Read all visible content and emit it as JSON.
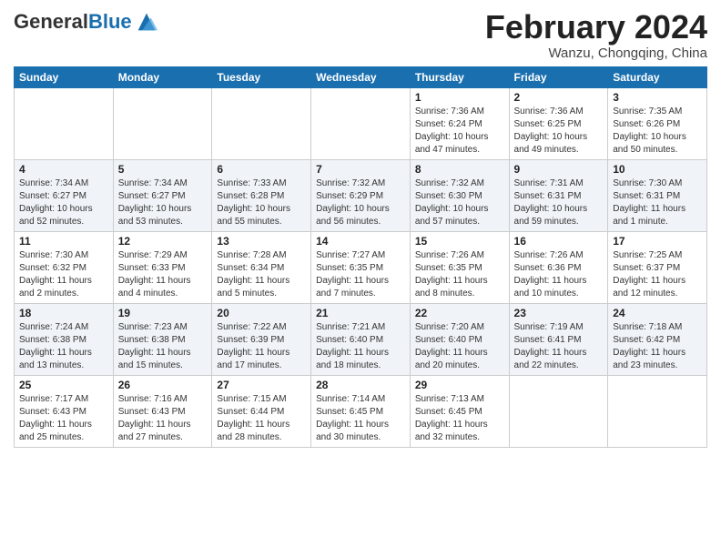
{
  "header": {
    "logo_general": "General",
    "logo_blue": "Blue",
    "month_title": "February 2024",
    "location": "Wanzu, Chongqing, China"
  },
  "weekdays": [
    "Sunday",
    "Monday",
    "Tuesday",
    "Wednesday",
    "Thursday",
    "Friday",
    "Saturday"
  ],
  "weeks": [
    [
      {
        "day": "",
        "detail": ""
      },
      {
        "day": "",
        "detail": ""
      },
      {
        "day": "",
        "detail": ""
      },
      {
        "day": "",
        "detail": ""
      },
      {
        "day": "1",
        "detail": "Sunrise: 7:36 AM\nSunset: 6:24 PM\nDaylight: 10 hours\nand 47 minutes."
      },
      {
        "day": "2",
        "detail": "Sunrise: 7:36 AM\nSunset: 6:25 PM\nDaylight: 10 hours\nand 49 minutes."
      },
      {
        "day": "3",
        "detail": "Sunrise: 7:35 AM\nSunset: 6:26 PM\nDaylight: 10 hours\nand 50 minutes."
      }
    ],
    [
      {
        "day": "4",
        "detail": "Sunrise: 7:34 AM\nSunset: 6:27 PM\nDaylight: 10 hours\nand 52 minutes."
      },
      {
        "day": "5",
        "detail": "Sunrise: 7:34 AM\nSunset: 6:27 PM\nDaylight: 10 hours\nand 53 minutes."
      },
      {
        "day": "6",
        "detail": "Sunrise: 7:33 AM\nSunset: 6:28 PM\nDaylight: 10 hours\nand 55 minutes."
      },
      {
        "day": "7",
        "detail": "Sunrise: 7:32 AM\nSunset: 6:29 PM\nDaylight: 10 hours\nand 56 minutes."
      },
      {
        "day": "8",
        "detail": "Sunrise: 7:32 AM\nSunset: 6:30 PM\nDaylight: 10 hours\nand 57 minutes."
      },
      {
        "day": "9",
        "detail": "Sunrise: 7:31 AM\nSunset: 6:31 PM\nDaylight: 10 hours\nand 59 minutes."
      },
      {
        "day": "10",
        "detail": "Sunrise: 7:30 AM\nSunset: 6:31 PM\nDaylight: 11 hours\nand 1 minute."
      }
    ],
    [
      {
        "day": "11",
        "detail": "Sunrise: 7:30 AM\nSunset: 6:32 PM\nDaylight: 11 hours\nand 2 minutes."
      },
      {
        "day": "12",
        "detail": "Sunrise: 7:29 AM\nSunset: 6:33 PM\nDaylight: 11 hours\nand 4 minutes."
      },
      {
        "day": "13",
        "detail": "Sunrise: 7:28 AM\nSunset: 6:34 PM\nDaylight: 11 hours\nand 5 minutes."
      },
      {
        "day": "14",
        "detail": "Sunrise: 7:27 AM\nSunset: 6:35 PM\nDaylight: 11 hours\nand 7 minutes."
      },
      {
        "day": "15",
        "detail": "Sunrise: 7:26 AM\nSunset: 6:35 PM\nDaylight: 11 hours\nand 8 minutes."
      },
      {
        "day": "16",
        "detail": "Sunrise: 7:26 AM\nSunset: 6:36 PM\nDaylight: 11 hours\nand 10 minutes."
      },
      {
        "day": "17",
        "detail": "Sunrise: 7:25 AM\nSunset: 6:37 PM\nDaylight: 11 hours\nand 12 minutes."
      }
    ],
    [
      {
        "day": "18",
        "detail": "Sunrise: 7:24 AM\nSunset: 6:38 PM\nDaylight: 11 hours\nand 13 minutes."
      },
      {
        "day": "19",
        "detail": "Sunrise: 7:23 AM\nSunset: 6:38 PM\nDaylight: 11 hours\nand 15 minutes."
      },
      {
        "day": "20",
        "detail": "Sunrise: 7:22 AM\nSunset: 6:39 PM\nDaylight: 11 hours\nand 17 minutes."
      },
      {
        "day": "21",
        "detail": "Sunrise: 7:21 AM\nSunset: 6:40 PM\nDaylight: 11 hours\nand 18 minutes."
      },
      {
        "day": "22",
        "detail": "Sunrise: 7:20 AM\nSunset: 6:40 PM\nDaylight: 11 hours\nand 20 minutes."
      },
      {
        "day": "23",
        "detail": "Sunrise: 7:19 AM\nSunset: 6:41 PM\nDaylight: 11 hours\nand 22 minutes."
      },
      {
        "day": "24",
        "detail": "Sunrise: 7:18 AM\nSunset: 6:42 PM\nDaylight: 11 hours\nand 23 minutes."
      }
    ],
    [
      {
        "day": "25",
        "detail": "Sunrise: 7:17 AM\nSunset: 6:43 PM\nDaylight: 11 hours\nand 25 minutes."
      },
      {
        "day": "26",
        "detail": "Sunrise: 7:16 AM\nSunset: 6:43 PM\nDaylight: 11 hours\nand 27 minutes."
      },
      {
        "day": "27",
        "detail": "Sunrise: 7:15 AM\nSunset: 6:44 PM\nDaylight: 11 hours\nand 28 minutes."
      },
      {
        "day": "28",
        "detail": "Sunrise: 7:14 AM\nSunset: 6:45 PM\nDaylight: 11 hours\nand 30 minutes."
      },
      {
        "day": "29",
        "detail": "Sunrise: 7:13 AM\nSunset: 6:45 PM\nDaylight: 11 hours\nand 32 minutes."
      },
      {
        "day": "",
        "detail": ""
      },
      {
        "day": "",
        "detail": ""
      }
    ]
  ]
}
